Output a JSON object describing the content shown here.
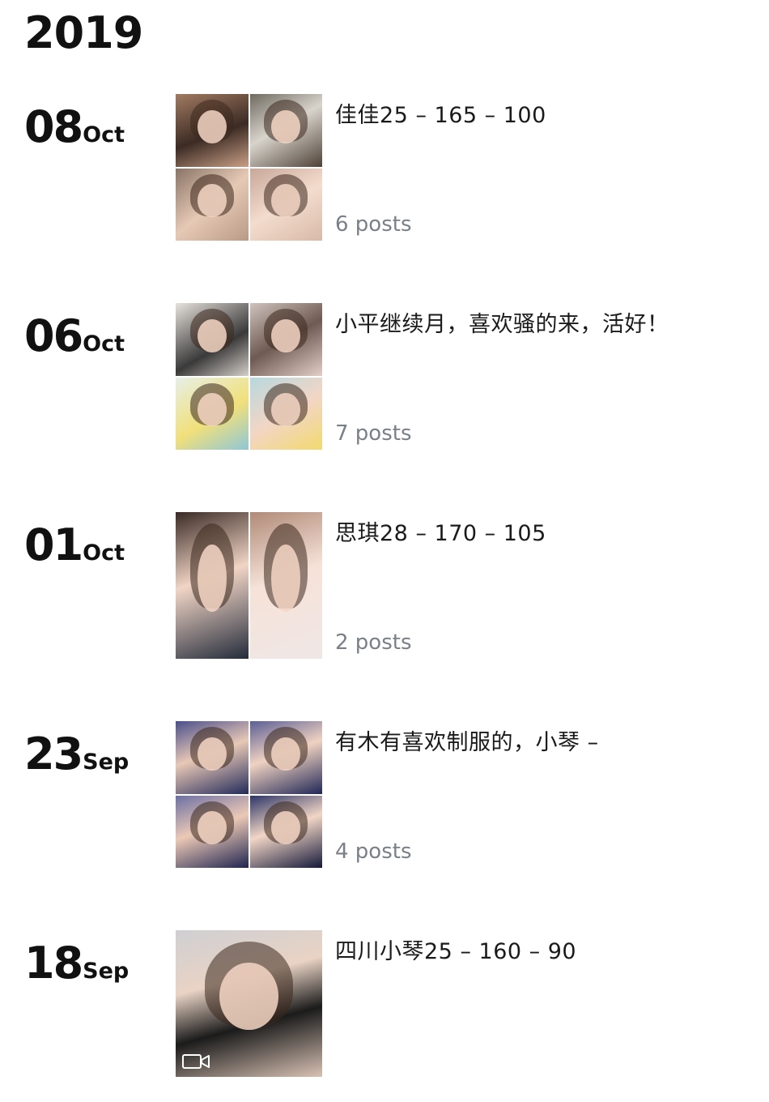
{
  "year": "2019",
  "entries": [
    {
      "day": "08",
      "month": "Oct",
      "caption": "佳佳25 – 165 – 100",
      "count": "6 posts",
      "photos": [
        {
          "bg": "linear-gradient(160deg,#a27b62,#3c2b24 55%,#c99f86)"
        },
        {
          "bg": "linear-gradient(150deg,#6f6a60,#d8d4cc 45%,#4f4238)"
        },
        {
          "bg": "linear-gradient(140deg,#8a7466,#e6c9b5 50%,#b99a86)"
        },
        {
          "bg": "linear-gradient(150deg,#c8a79a,#f3dccd 50%,#d9b9a8)"
        }
      ]
    },
    {
      "day": "06",
      "month": "Oct",
      "caption": "小平继续月，喜欢骚的来，活好！",
      "count": "7 posts",
      "photos": [
        {
          "bg": "linear-gradient(150deg,#e8e2dc,#3a3a3a 60%,#d6cfc9)"
        },
        {
          "bg": "linear-gradient(150deg,#cfc3bd,#6e5a52 50%,#e4cfc8)"
        },
        {
          "bg": "linear-gradient(150deg,#e7efe6,#f1e07a 55%,#8ec7d6)"
        },
        {
          "bg": "linear-gradient(150deg,#b7d8de,#f2d6c6 50%,#f3d96f)"
        }
      ]
    },
    {
      "day": "01",
      "month": "Oct",
      "caption": "思琪28 – 170 – 105",
      "count": "2 posts",
      "photos": [
        {
          "bg": "linear-gradient(160deg,#3a2a25,#f1d5c6 45%,#232b3a)"
        },
        {
          "bg": "linear-gradient(160deg,#b08a78,#f6e2d8 45%,#efe7e6)"
        }
      ]
    },
    {
      "day": "23",
      "month": "Sep",
      "caption": "有木有喜欢制服的，小琴 –",
      "count": "4 posts",
      "photos": [
        {
          "bg": "linear-gradient(160deg,#4a4f8a,#e8c8b6 45%,#232a5a)"
        },
        {
          "bg": "linear-gradient(160deg,#5b5f95,#f0d2c1 45%,#202756)"
        },
        {
          "bg": "linear-gradient(160deg,#6c6fa3,#ecc9b6 45%,#1f2450)"
        },
        {
          "bg": "linear-gradient(160deg,#2c3566,#f2d6c6 45%,#15193a)"
        }
      ]
    },
    {
      "day": "18",
      "month": "Sep",
      "caption": "四川小琴25 – 160 – 90",
      "count": "",
      "video": true,
      "photos": [
        {
          "bg": "linear-gradient(165deg,#cfcfd2,#e9d3c5 35%,#1b1b1b 62%,#d9c2b4)"
        }
      ]
    }
  ]
}
